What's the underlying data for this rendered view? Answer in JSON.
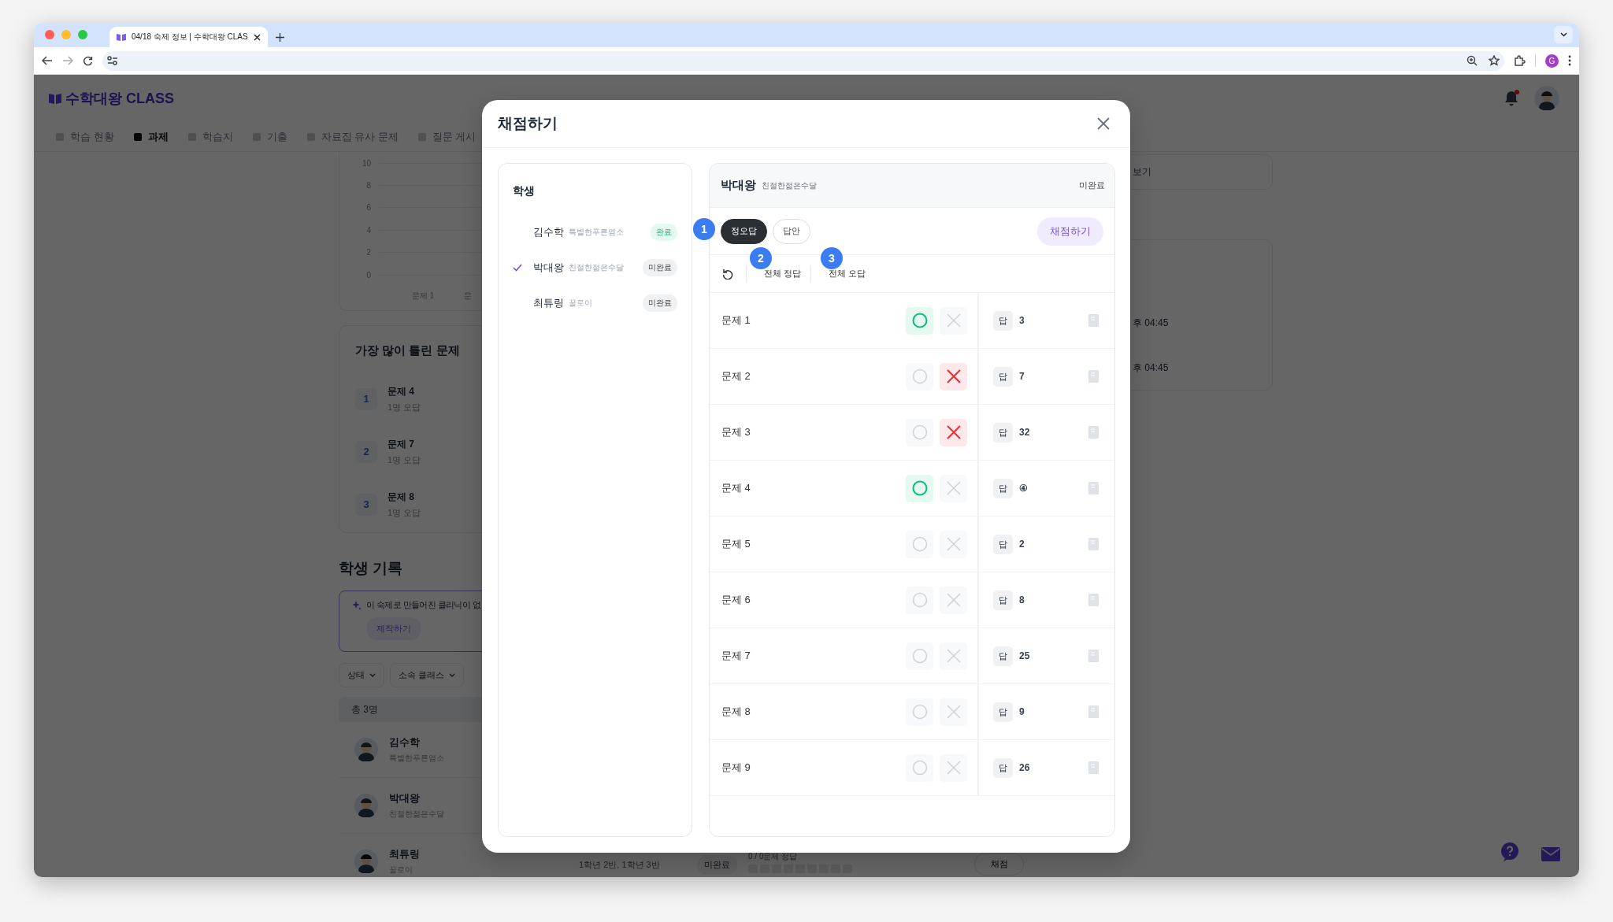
{
  "browser": {
    "tab_title": "04/18 숙제 정보 | 수학대왕 CLAS",
    "profile_initial": "G"
  },
  "app": {
    "logo": "수학대왕 CLASS",
    "nav": [
      {
        "label": "학습 현황",
        "selected": false
      },
      {
        "label": "과제",
        "selected": true
      },
      {
        "label": "학습지",
        "selected": false
      },
      {
        "label": "기출",
        "selected": false
      },
      {
        "label": "자료집 유사 문제",
        "selected": false
      },
      {
        "label": "질문 게시",
        "selected": false
      }
    ],
    "chart": {
      "y_ticks": [
        "10",
        "8",
        "6",
        "4",
        "2",
        "0"
      ],
      "x_labels": [
        "문제 1",
        "문"
      ]
    },
    "most_wrong": {
      "title": "가장 많이 틀린 문제",
      "items": [
        {
          "rank": "1",
          "title": "문제 4",
          "detail": "1명 오답"
        },
        {
          "rank": "2",
          "title": "문제 7",
          "detail": "1명 오답"
        },
        {
          "rank": "3",
          "title": "문제 8",
          "detail": "1명 오답"
        }
      ]
    },
    "student_record": {
      "title": "학생 기록",
      "notice": "이 숙제로 만들어진 클리닉이 없",
      "create_button": "제작하기",
      "filters": [
        "상태",
        "소속 클래스"
      ],
      "total": "총 3명",
      "students": [
        {
          "name": "김수학",
          "nickname": "특별한푸른염소"
        },
        {
          "name": "박대왕",
          "nickname": "친절한젊은수달"
        },
        {
          "name": "최튜링",
          "nickname": "꿀로이",
          "classes": "1학년 2반, 1학년 3반",
          "status": "미완료",
          "score": "0 / 0문제 정답",
          "grade_button": "채점"
        }
      ]
    },
    "side": {
      "link": "보기",
      "times": [
        "후 04:45",
        "후 04:45"
      ]
    }
  },
  "modal": {
    "title": "채점하기",
    "students_heading": "학생",
    "students": [
      {
        "name": "김수학",
        "nickname": "특별한푸른염소",
        "status": "완료",
        "done": true,
        "selected": false
      },
      {
        "name": "박대왕",
        "nickname": "친절한젊은수달",
        "status": "미완료",
        "done": false,
        "selected": true
      },
      {
        "name": "최튜링",
        "nickname": "꿀로이",
        "status": "미완료",
        "done": false,
        "selected": false
      }
    ],
    "detail": {
      "name": "박대왕",
      "nickname": "친절한젊은수달",
      "status": "미완료",
      "tabs": [
        {
          "label": "정오답",
          "selected": true
        },
        {
          "label": "답안",
          "selected": false
        }
      ],
      "grade_button": "채점하기",
      "steps": [
        "1",
        "2",
        "3"
      ],
      "actions": [
        "전체 정답",
        "전체 오답"
      ],
      "rows": [
        {
          "label": "문제 1",
          "correct": true,
          "wrong": false,
          "answer_tag": "답",
          "answer": "3"
        },
        {
          "label": "문제 2",
          "correct": false,
          "wrong": true,
          "answer_tag": "답",
          "answer": "7"
        },
        {
          "label": "문제 3",
          "correct": false,
          "wrong": true,
          "answer_tag": "답",
          "answer": "32"
        },
        {
          "label": "문제 4",
          "correct": true,
          "wrong": false,
          "answer_tag": "답",
          "answer": "④"
        },
        {
          "label": "문제 5",
          "correct": false,
          "wrong": false,
          "answer_tag": "답",
          "answer": "2"
        },
        {
          "label": "문제 6",
          "correct": false,
          "wrong": false,
          "answer_tag": "답",
          "answer": "8"
        },
        {
          "label": "문제 7",
          "correct": false,
          "wrong": false,
          "answer_tag": "답",
          "answer": "25"
        },
        {
          "label": "문제 8",
          "correct": false,
          "wrong": false,
          "answer_tag": "답",
          "answer": "9"
        },
        {
          "label": "문제 9",
          "correct": false,
          "wrong": false,
          "answer_tag": "답",
          "answer": "26"
        }
      ]
    }
  }
}
